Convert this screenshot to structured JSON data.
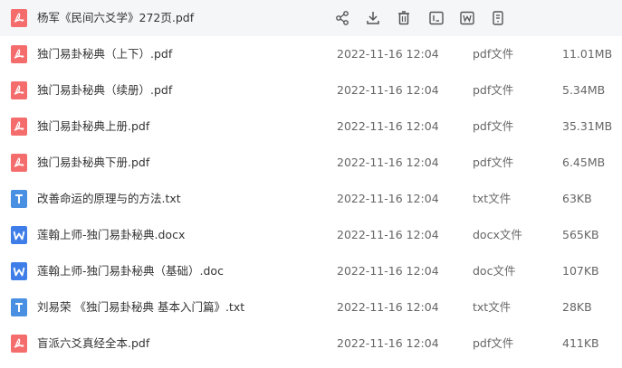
{
  "colors": {
    "pdf_icon": "#f56c6c",
    "txt_icon": "#4a90e2",
    "doc_icon": "#3f7ee8",
    "row_highlight": "#f5f6f8",
    "text_primary": "#333333",
    "text_secondary": "#666666"
  },
  "toolbar": {
    "icons": [
      "share-icon",
      "download-icon",
      "delete-icon",
      "rename-icon",
      "open-with-word-icon",
      "more-file-icon"
    ]
  },
  "files": [
    {
      "name": "杨军《民间六爻学》272页.pdf",
      "date": "",
      "type": "",
      "size": "",
      "icon": "pdf-icon",
      "highlighted": true
    },
    {
      "name": "独门易卦秘典（上下）.pdf",
      "date": "2022-11-16 12:04",
      "type": "pdf文件",
      "size": "11.01MB",
      "icon": "pdf-icon"
    },
    {
      "name": "独门易卦秘典（续册）.pdf",
      "date": "2022-11-16 12:04",
      "type": "pdf文件",
      "size": "5.34MB",
      "icon": "pdf-icon"
    },
    {
      "name": "独门易卦秘典上册.pdf",
      "date": "2022-11-16 12:04",
      "type": "pdf文件",
      "size": "35.31MB",
      "icon": "pdf-icon"
    },
    {
      "name": "独门易卦秘典下册.pdf",
      "date": "2022-11-16 12:04",
      "type": "pdf文件",
      "size": "6.45MB",
      "icon": "pdf-icon"
    },
    {
      "name": "改善命运的原理与的方法.txt",
      "date": "2022-11-16 12:04",
      "type": "txt文件",
      "size": "63KB",
      "icon": "txt-icon"
    },
    {
      "name": "莲翰上师-独门易卦秘典.docx",
      "date": "2022-11-16 12:04",
      "type": "docx文件",
      "size": "565KB",
      "icon": "word-icon"
    },
    {
      "name": "莲翰上师-独门易卦秘典（基础）.doc",
      "date": "2022-11-16 12:04",
      "type": "doc文件",
      "size": "107KB",
      "icon": "word-icon"
    },
    {
      "name": "刘易荣 《独门易卦秘典 基本入门篇》.txt",
      "date": "2022-11-16 12:04",
      "type": "txt文件",
      "size": "28KB",
      "icon": "txt-icon"
    },
    {
      "name": "盲派六爻真经全本.pdf",
      "date": "2022-11-16 12:04",
      "type": "pdf文件",
      "size": "411KB",
      "icon": "pdf-icon"
    }
  ]
}
